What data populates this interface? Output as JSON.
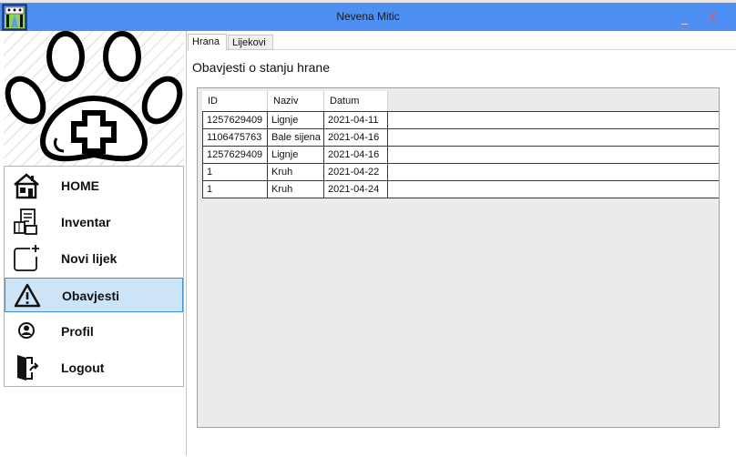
{
  "window": {
    "title": "Nevena Mitic",
    "close_glyph": "X",
    "icon": "app-paw-icon"
  },
  "sidebar": {
    "logo_icon": "paw-medical-cross-icon",
    "items": [
      {
        "label": "HOME",
        "icon": "home-icon",
        "active": false
      },
      {
        "label": "Inventar",
        "icon": "inventory-icon",
        "active": false
      },
      {
        "label": "Novi lijek",
        "icon": "new-medicine-icon",
        "active": false
      },
      {
        "label": "Obavjesti",
        "icon": "warning-icon",
        "active": true
      },
      {
        "label": "Profil",
        "icon": "profile-icon",
        "active": false
      },
      {
        "label": "Logout",
        "icon": "logout-icon",
        "active": false
      }
    ]
  },
  "tabs": [
    {
      "label": "Hrana",
      "selected": true
    },
    {
      "label": "Lijekovi",
      "selected": false
    }
  ],
  "main": {
    "heading": "Obavjesti o stanju hrane",
    "table": {
      "columns": [
        "ID",
        "Naziv",
        "Datum"
      ],
      "rows": [
        [
          "1257629409",
          "Lignje",
          "2021-04-11"
        ],
        [
          "1106475763",
          "Bale sijena",
          "2021-04-16"
        ],
        [
          "1257629409",
          "Lignje",
          "2021-04-16"
        ],
        [
          "1",
          "Kruh",
          "2021-04-22"
        ],
        [
          "1",
          "Kruh",
          "2021-04-24"
        ]
      ]
    }
  },
  "colors": {
    "titlebar": "#4d8ff2",
    "active_item_bg": "#cce4f7",
    "active_item_border": "#3c8fd9",
    "close": "#ff4d4d"
  }
}
